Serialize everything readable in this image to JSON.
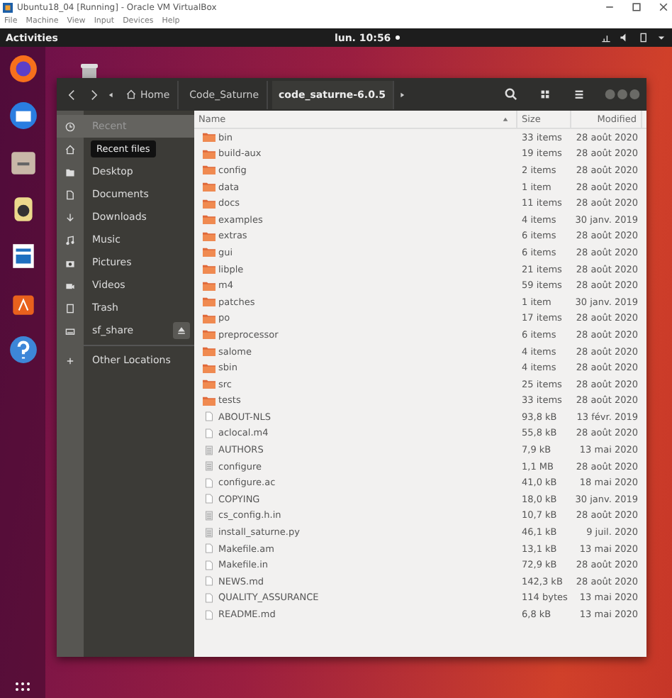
{
  "vbox": {
    "title": "Ubuntu18_04 [Running] - Oracle VM VirtualBox",
    "menu": [
      "File",
      "Machine",
      "View",
      "Input",
      "Devices",
      "Help"
    ]
  },
  "topbar": {
    "activities": "Activities",
    "clock": "lun. 10:56"
  },
  "pathbar": [
    {
      "label": "Home",
      "selected": false
    },
    {
      "label": "Code_Saturne",
      "selected": false
    },
    {
      "label": "code_saturne-6.0.5",
      "selected": true
    }
  ],
  "sidebar": [
    {
      "label": "Recent",
      "selected": true
    },
    {
      "selected": false
    },
    {
      "label": "Desktop",
      "selected": false
    },
    {
      "label": "Documents",
      "selected": false
    },
    {
      "label": "Downloads",
      "selected": false
    },
    {
      "label": "Music",
      "selected": false
    },
    {
      "label": "Pictures",
      "selected": false
    },
    {
      "label": "Videos",
      "selected": false
    },
    {
      "label": "Trash",
      "selected": false
    },
    {
      "label": "sf_share",
      "selected": false,
      "eject": true
    },
    {
      "label": "Other Locations",
      "selected": false
    }
  ],
  "tooltip": {
    "text": "Recent files"
  },
  "columns": [
    {
      "label": "Name",
      "sorted": true
    },
    {
      "label": "Size"
    },
    {
      "label": "Modified"
    }
  ],
  "rows": [
    {
      "kind": "folder",
      "name": "bin",
      "size": "33 items",
      "modified": "28 août 2020"
    },
    {
      "kind": "folder",
      "name": "build-aux",
      "size": "19 items",
      "modified": "28 août 2020"
    },
    {
      "kind": "folder",
      "name": "config",
      "size": "2 items",
      "modified": "28 août 2020"
    },
    {
      "kind": "folder",
      "name": "data",
      "size": "1 item",
      "modified": "28 août 2020"
    },
    {
      "kind": "folder",
      "name": "docs",
      "size": "11 items",
      "modified": "28 août 2020"
    },
    {
      "kind": "folder",
      "name": "examples",
      "size": "4 items",
      "modified": "30 janv. 2019"
    },
    {
      "kind": "folder",
      "name": "extras",
      "size": "6 items",
      "modified": "28 août 2020"
    },
    {
      "kind": "folder",
      "name": "gui",
      "size": "6 items",
      "modified": "28 août 2020"
    },
    {
      "kind": "folder",
      "name": "libple",
      "size": "21 items",
      "modified": "28 août 2020"
    },
    {
      "kind": "folder",
      "name": "m4",
      "size": "59 items",
      "modified": "28 août 2020"
    },
    {
      "kind": "folder",
      "name": "patches",
      "size": "1 item",
      "modified": "30 janv. 2019"
    },
    {
      "kind": "folder",
      "name": "po",
      "size": "17 items",
      "modified": "28 août 2020"
    },
    {
      "kind": "folder",
      "name": "preprocessor",
      "size": "6 items",
      "modified": "28 août 2020"
    },
    {
      "kind": "folder",
      "name": "salome",
      "size": "4 items",
      "modified": "28 août 2020"
    },
    {
      "kind": "folder",
      "name": "sbin",
      "size": "4 items",
      "modified": "28 août 2020"
    },
    {
      "kind": "folder",
      "name": "src",
      "size": "25 items",
      "modified": "28 août 2020"
    },
    {
      "kind": "folder",
      "name": "tests",
      "size": "33 items",
      "modified": "28 août 2020"
    },
    {
      "kind": "file",
      "name": "ABOUT-NLS",
      "size": "93,8 kB",
      "modified": "13 févr. 2019"
    },
    {
      "kind": "file",
      "name": "aclocal.m4",
      "size": "55,8 kB",
      "modified": "28 août 2020"
    },
    {
      "kind": "text",
      "name": "AUTHORS",
      "size": "7,9 kB",
      "modified": "13 mai 2020"
    },
    {
      "kind": "text",
      "name": "configure",
      "size": "1,1 MB",
      "modified": "28 août 2020"
    },
    {
      "kind": "file",
      "name": "configure.ac",
      "size": "41,0 kB",
      "modified": "18 mai 2020"
    },
    {
      "kind": "file",
      "name": "COPYING",
      "size": "18,0 kB",
      "modified": "30 janv. 2019"
    },
    {
      "kind": "text",
      "name": "cs_config.h.in",
      "size": "10,7 kB",
      "modified": "28 août 2020"
    },
    {
      "kind": "text",
      "name": "install_saturne.py",
      "size": "46,1 kB",
      "modified": "9 juil. 2020"
    },
    {
      "kind": "file",
      "name": "Makefile.am",
      "size": "13,1 kB",
      "modified": "13 mai 2020"
    },
    {
      "kind": "file",
      "name": "Makefile.in",
      "size": "72,9 kB",
      "modified": "28 août 2020"
    },
    {
      "kind": "file",
      "name": "NEWS.md",
      "size": "142,3 kB",
      "modified": "28 août 2020"
    },
    {
      "kind": "file",
      "name": "QUALITY_ASSURANCE",
      "size": "114 bytes",
      "modified": "13 mai 2020"
    },
    {
      "kind": "file",
      "name": "README.md",
      "size": "6,8 kB",
      "modified": "13 mai 2020"
    }
  ]
}
